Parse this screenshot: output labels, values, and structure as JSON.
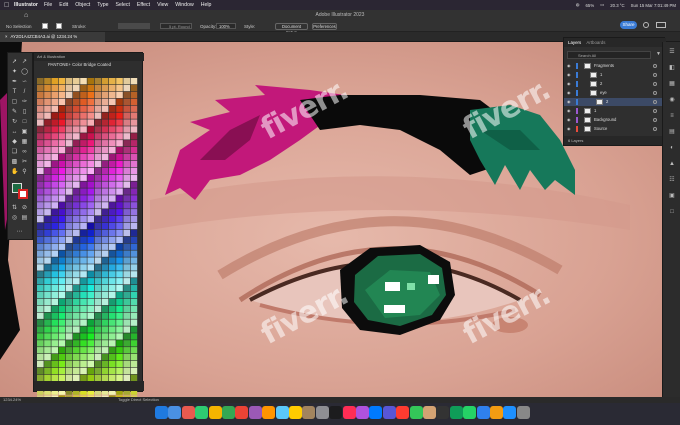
{
  "menubar": {
    "app_name": "Illustrator",
    "items": [
      "File",
      "Edit",
      "Object",
      "Type",
      "Select",
      "Effect",
      "View",
      "Window",
      "Help"
    ],
    "battery": "65%",
    "temperature": "20.3 °C",
    "datetime": "Sun 15 Mar  7:01:49 PM"
  },
  "control_bar": {
    "window_title": "Adobe Illustrator 2023",
    "selection_label": "No Selection",
    "stroke_label": "Stroke:",
    "brush_label": "5 pt. Round",
    "opacity_label": "Opacity:",
    "opacity_value": "100%",
    "style_label": "Style:",
    "doc_setup_label": "Document Setup",
    "preferences_label": "Preferences",
    "share_label": "Share"
  },
  "document": {
    "tab_title": "AY2D1A4ZCB4A3.ai @ 1234.24 % (CMYK/Preview)",
    "zoom_status": "1234.24%",
    "tool_status": "Toggle Direct Selection"
  },
  "swatches_panel": {
    "header": "Art & Illustration",
    "library_title": "PANTONE+ Color Bridge Coated"
  },
  "layers_panel": {
    "tabs": [
      "Layers",
      "Artboards"
    ],
    "search_placeholder": "Search All",
    "rows": [
      {
        "label": "Fragments",
        "color": "#3a7bd5"
      },
      {
        "label": "1",
        "color": "#3a7bd5"
      },
      {
        "label": "2",
        "color": "#3a7bd5"
      },
      {
        "label": "eye",
        "color": "#3a7bd5"
      },
      {
        "label": "2",
        "color": "#3a7bd5"
      },
      {
        "label": "1",
        "color": "#9b59d0"
      },
      {
        "label": "Background",
        "color": "#9b59d0"
      },
      {
        "label": "Source",
        "color": "#e94b3c"
      }
    ],
    "footer": "6 Layers"
  },
  "watermark_text": "fiverr.",
  "colors": {
    "eyebrow_pink": "#c2187a",
    "eyebrow_black": "#0a0a0a",
    "eyebrow_green": "#16785a",
    "iris_green": "#1b6b44",
    "accent_blue": "#3a7bd5"
  },
  "icons": [
    "apple-icon",
    "home-icon",
    "search-icon",
    "eye-icon",
    "filter-icon",
    "wifi-icon",
    "battery-icon"
  ]
}
